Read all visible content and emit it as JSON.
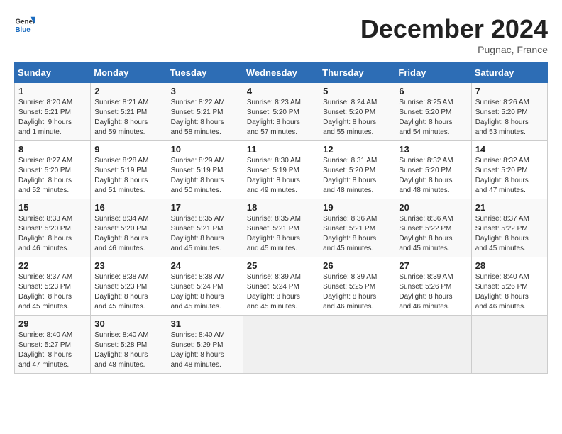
{
  "logo": {
    "line1": "General",
    "line2": "Blue"
  },
  "title": "December 2024",
  "location": "Pugnac, France",
  "days_of_week": [
    "Sunday",
    "Monday",
    "Tuesday",
    "Wednesday",
    "Thursday",
    "Friday",
    "Saturday"
  ],
  "weeks": [
    [
      {
        "day": "1",
        "detail": "Sunrise: 8:20 AM\nSunset: 5:21 PM\nDaylight: 9 hours\nand 1 minute."
      },
      {
        "day": "2",
        "detail": "Sunrise: 8:21 AM\nSunset: 5:21 PM\nDaylight: 8 hours\nand 59 minutes."
      },
      {
        "day": "3",
        "detail": "Sunrise: 8:22 AM\nSunset: 5:21 PM\nDaylight: 8 hours\nand 58 minutes."
      },
      {
        "day": "4",
        "detail": "Sunrise: 8:23 AM\nSunset: 5:20 PM\nDaylight: 8 hours\nand 57 minutes."
      },
      {
        "day": "5",
        "detail": "Sunrise: 8:24 AM\nSunset: 5:20 PM\nDaylight: 8 hours\nand 55 minutes."
      },
      {
        "day": "6",
        "detail": "Sunrise: 8:25 AM\nSunset: 5:20 PM\nDaylight: 8 hours\nand 54 minutes."
      },
      {
        "day": "7",
        "detail": "Sunrise: 8:26 AM\nSunset: 5:20 PM\nDaylight: 8 hours\nand 53 minutes."
      }
    ],
    [
      {
        "day": "8",
        "detail": "Sunrise: 8:27 AM\nSunset: 5:20 PM\nDaylight: 8 hours\nand 52 minutes."
      },
      {
        "day": "9",
        "detail": "Sunrise: 8:28 AM\nSunset: 5:19 PM\nDaylight: 8 hours\nand 51 minutes."
      },
      {
        "day": "10",
        "detail": "Sunrise: 8:29 AM\nSunset: 5:19 PM\nDaylight: 8 hours\nand 50 minutes."
      },
      {
        "day": "11",
        "detail": "Sunrise: 8:30 AM\nSunset: 5:19 PM\nDaylight: 8 hours\nand 49 minutes."
      },
      {
        "day": "12",
        "detail": "Sunrise: 8:31 AM\nSunset: 5:20 PM\nDaylight: 8 hours\nand 48 minutes."
      },
      {
        "day": "13",
        "detail": "Sunrise: 8:32 AM\nSunset: 5:20 PM\nDaylight: 8 hours\nand 48 minutes."
      },
      {
        "day": "14",
        "detail": "Sunrise: 8:32 AM\nSunset: 5:20 PM\nDaylight: 8 hours\nand 47 minutes."
      }
    ],
    [
      {
        "day": "15",
        "detail": "Sunrise: 8:33 AM\nSunset: 5:20 PM\nDaylight: 8 hours\nand 46 minutes."
      },
      {
        "day": "16",
        "detail": "Sunrise: 8:34 AM\nSunset: 5:20 PM\nDaylight: 8 hours\nand 46 minutes."
      },
      {
        "day": "17",
        "detail": "Sunrise: 8:35 AM\nSunset: 5:21 PM\nDaylight: 8 hours\nand 45 minutes."
      },
      {
        "day": "18",
        "detail": "Sunrise: 8:35 AM\nSunset: 5:21 PM\nDaylight: 8 hours\nand 45 minutes."
      },
      {
        "day": "19",
        "detail": "Sunrise: 8:36 AM\nSunset: 5:21 PM\nDaylight: 8 hours\nand 45 minutes."
      },
      {
        "day": "20",
        "detail": "Sunrise: 8:36 AM\nSunset: 5:22 PM\nDaylight: 8 hours\nand 45 minutes."
      },
      {
        "day": "21",
        "detail": "Sunrise: 8:37 AM\nSunset: 5:22 PM\nDaylight: 8 hours\nand 45 minutes."
      }
    ],
    [
      {
        "day": "22",
        "detail": "Sunrise: 8:37 AM\nSunset: 5:23 PM\nDaylight: 8 hours\nand 45 minutes."
      },
      {
        "day": "23",
        "detail": "Sunrise: 8:38 AM\nSunset: 5:23 PM\nDaylight: 8 hours\nand 45 minutes."
      },
      {
        "day": "24",
        "detail": "Sunrise: 8:38 AM\nSunset: 5:24 PM\nDaylight: 8 hours\nand 45 minutes."
      },
      {
        "day": "25",
        "detail": "Sunrise: 8:39 AM\nSunset: 5:24 PM\nDaylight: 8 hours\nand 45 minutes."
      },
      {
        "day": "26",
        "detail": "Sunrise: 8:39 AM\nSunset: 5:25 PM\nDaylight: 8 hours\nand 46 minutes."
      },
      {
        "day": "27",
        "detail": "Sunrise: 8:39 AM\nSunset: 5:26 PM\nDaylight: 8 hours\nand 46 minutes."
      },
      {
        "day": "28",
        "detail": "Sunrise: 8:40 AM\nSunset: 5:26 PM\nDaylight: 8 hours\nand 46 minutes."
      }
    ],
    [
      {
        "day": "29",
        "detail": "Sunrise: 8:40 AM\nSunset: 5:27 PM\nDaylight: 8 hours\nand 47 minutes."
      },
      {
        "day": "30",
        "detail": "Sunrise: 8:40 AM\nSunset: 5:28 PM\nDaylight: 8 hours\nand 48 minutes."
      },
      {
        "day": "31",
        "detail": "Sunrise: 8:40 AM\nSunset: 5:29 PM\nDaylight: 8 hours\nand 48 minutes."
      },
      {
        "day": "",
        "detail": ""
      },
      {
        "day": "",
        "detail": ""
      },
      {
        "day": "",
        "detail": ""
      },
      {
        "day": "",
        "detail": ""
      }
    ]
  ]
}
